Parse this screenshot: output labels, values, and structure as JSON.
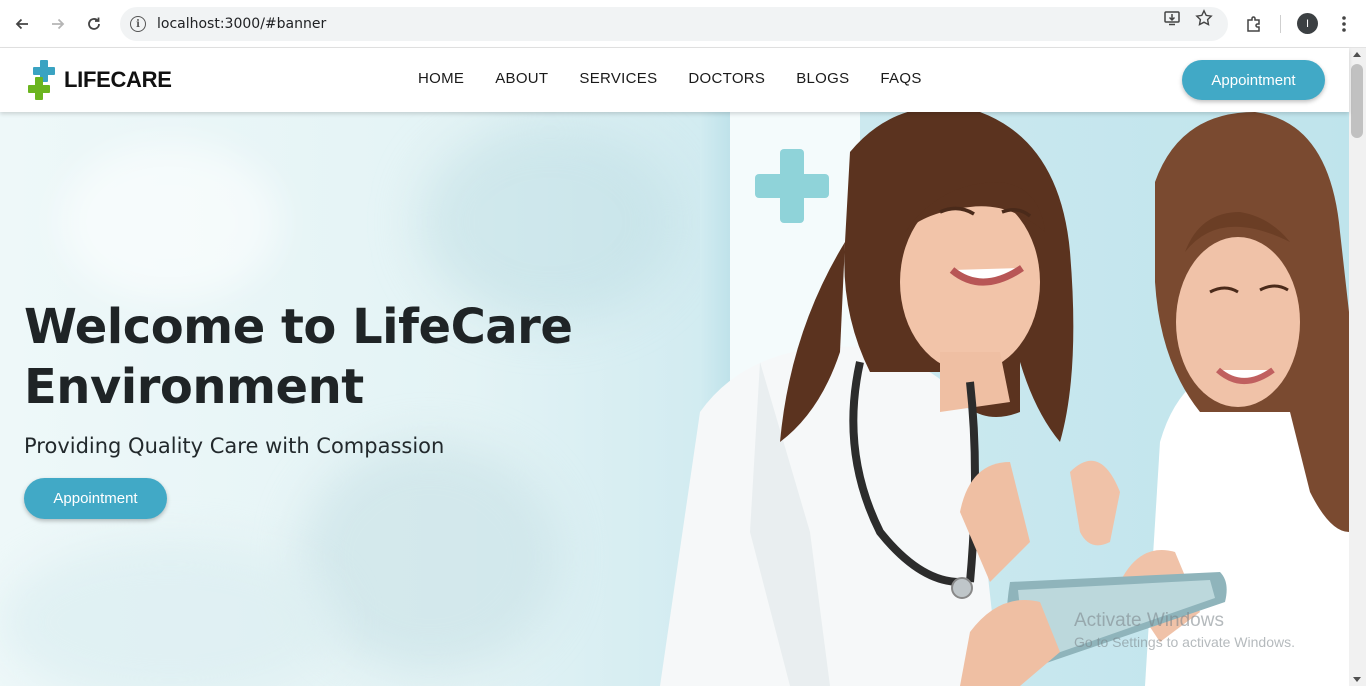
{
  "browser": {
    "url": "localhost:3000/#banner",
    "profile_initial": "I"
  },
  "header": {
    "logo_text": "LIFECARE",
    "nav": [
      "HOME",
      "ABOUT",
      "SERVICES",
      "DOCTORS",
      "BLOGS",
      "FAQS"
    ],
    "appointment_label": "Appointment"
  },
  "banner": {
    "title": "Welcome to LifeCare Environment",
    "subtitle": "Providing Quality Care with Compassion",
    "appointment_label": "Appointment"
  },
  "watermark": {
    "line1": "Activate Windows",
    "line2": "Go to Settings to activate Windows."
  },
  "colors": {
    "accent": "#41a9c6",
    "logo_blue": "#3aa3c2",
    "logo_green": "#6bb51f"
  }
}
